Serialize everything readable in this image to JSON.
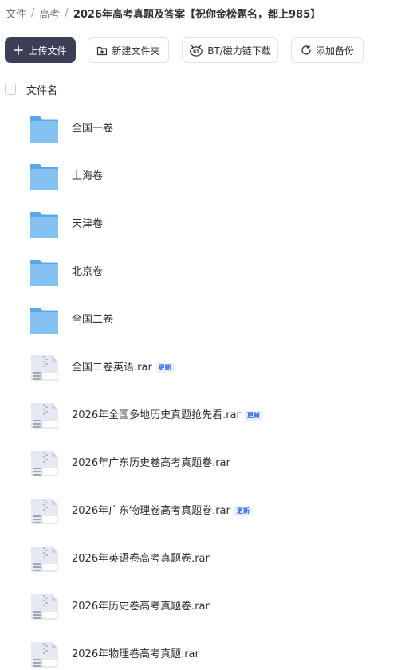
{
  "breadcrumb": {
    "items": [
      "文件",
      "高考"
    ],
    "separator": "/",
    "current": "2026年高考真题及答案【祝你金榜题名，都上985】"
  },
  "toolbar": {
    "upload_label": "上传文件",
    "new_folder_label": "新建文件夹",
    "bt_label": "BT/磁力链下载",
    "backup_label": "添加备份"
  },
  "list_header": {
    "name_label": "文件名"
  },
  "files": [
    {
      "name": "全国一卷",
      "type": "folder",
      "badge": ""
    },
    {
      "name": "上海卷",
      "type": "folder",
      "badge": ""
    },
    {
      "name": "天津卷",
      "type": "folder",
      "badge": ""
    },
    {
      "name": "北京卷",
      "type": "folder",
      "badge": ""
    },
    {
      "name": "全国二卷",
      "type": "folder",
      "badge": ""
    },
    {
      "name": "全国二卷英语.rar",
      "type": "archive",
      "badge": "更新"
    },
    {
      "name": "2026年全国多地历史真题抢先看.rar",
      "type": "archive",
      "badge": "更新"
    },
    {
      "name": "2026年广东历史卷高考真题卷.rar",
      "type": "archive",
      "badge": ""
    },
    {
      "name": "2026年广东物理卷高考真题卷.rar",
      "type": "archive",
      "badge": "更新"
    },
    {
      "name": "2026年英语卷高考真题卷.rar",
      "type": "archive",
      "badge": ""
    },
    {
      "name": "2026年历史卷高考真题卷.rar",
      "type": "archive",
      "badge": ""
    },
    {
      "name": "2026年物理卷高考真题.rar",
      "type": "archive",
      "badge": ""
    }
  ],
  "colors": {
    "primary_button": "#3a3f55",
    "folder": "#7fbcf0",
    "badge_text": "#2b62e8",
    "badge_bg": "#e8f0ff"
  }
}
